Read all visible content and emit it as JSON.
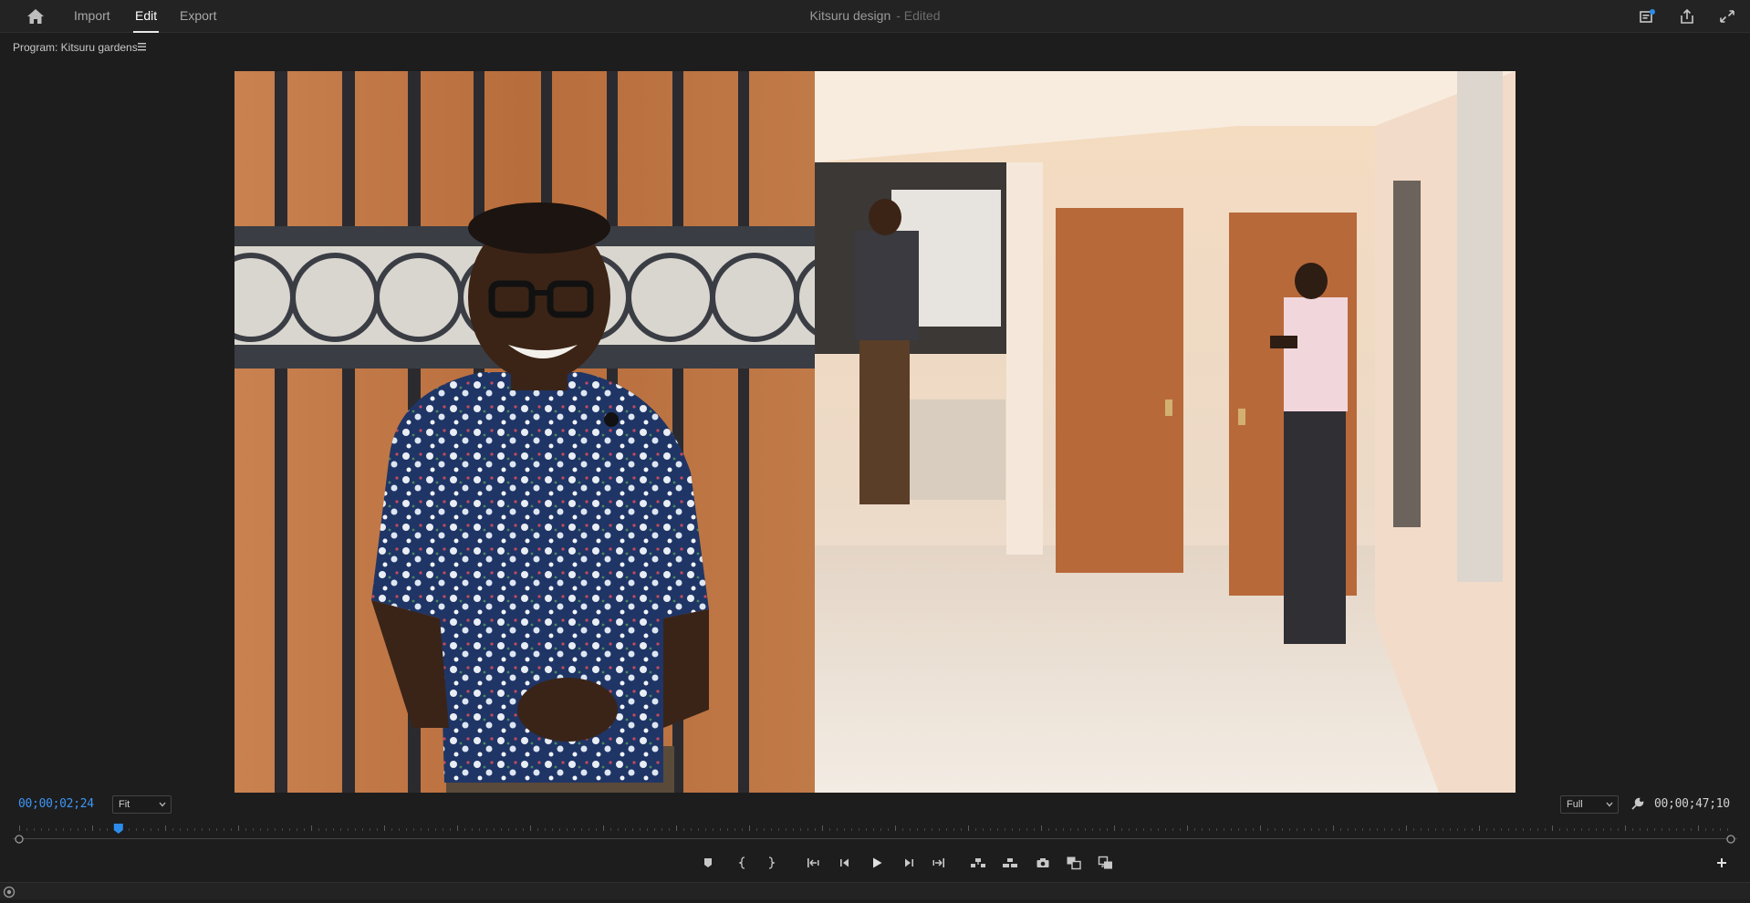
{
  "nav": {
    "tabs": [
      {
        "label": "Import"
      },
      {
        "label": "Edit"
      },
      {
        "label": "Export"
      }
    ],
    "active_tab": "Edit"
  },
  "document": {
    "title": "Kitsuru design",
    "status": "- Edited"
  },
  "panel": {
    "title": "Program: Kitsuru gardens"
  },
  "playback": {
    "current_timecode": "00;00;02;24",
    "duration_timecode": "00;00;47;10",
    "zoom_select": "Fit",
    "resolution_select": "Full",
    "playhead_fraction": 0.058
  },
  "colors": {
    "accent": "#2d8ceb",
    "background": "#1d1d1d",
    "bar": "#232323"
  },
  "icons": {
    "home": "home-icon",
    "quick_export": "quick-export-icon",
    "share": "share-icon",
    "fullscreen": "fullscreen-icon",
    "panel_menu": "hamburger-menu-icon",
    "settings": "wrench-icon",
    "add": "plus-icon",
    "status": "render-status-icon"
  },
  "transport": [
    "add-marker",
    "mark-in",
    "mark-out",
    "go-to-in",
    "step-back",
    "play",
    "step-forward",
    "go-to-out",
    "lift",
    "extract",
    "export-frame",
    "comparison-view",
    "proxy-toggle"
  ]
}
